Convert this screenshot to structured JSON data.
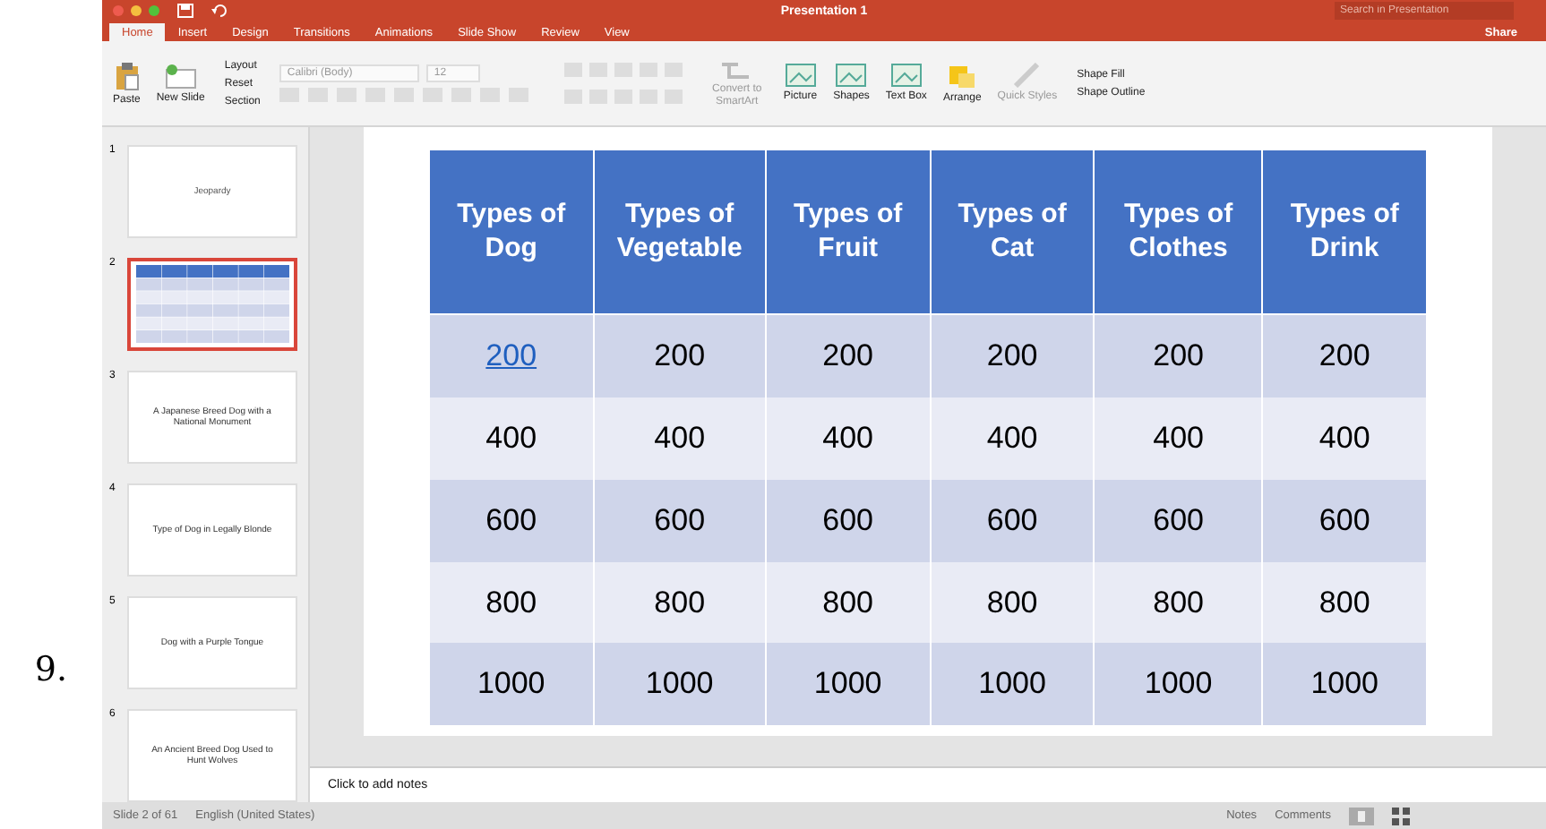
{
  "step_number": "9.",
  "window": {
    "title": "Presentation 1"
  },
  "search": {
    "placeholder": "Search in Presentation"
  },
  "share": "Share",
  "tabs": [
    {
      "label": "Home",
      "selected": true
    },
    {
      "label": "Insert",
      "selected": false
    },
    {
      "label": "Design",
      "selected": false
    },
    {
      "label": "Transitions",
      "selected": false
    },
    {
      "label": "Animations",
      "selected": false
    },
    {
      "label": "Slide Show",
      "selected": false
    },
    {
      "label": "Review",
      "selected": false
    },
    {
      "label": "View",
      "selected": false
    }
  ],
  "ribbon": {
    "paste": "Paste",
    "new_slide": "New Slide",
    "slide_options": [
      "Layout",
      "Reset",
      "Section"
    ],
    "font_name": "Calibri (Body)",
    "font_size": "12",
    "convert": "Convert to SmartArt",
    "insert_buttons": [
      "Picture",
      "Shapes",
      "Text Box"
    ],
    "arrange": "Arrange",
    "quick_styles": "Quick Styles",
    "shape_options": [
      "Shape Fill",
      "Shape Outline"
    ]
  },
  "slides": [
    {
      "number": "1",
      "kind": "title",
      "text": "Jeopardy",
      "selected": false
    },
    {
      "number": "2",
      "kind": "table",
      "selected": true
    },
    {
      "number": "3",
      "kind": "text",
      "text": "A Japanese Breed Dog with a National Monument",
      "selected": false
    },
    {
      "number": "4",
      "kind": "text",
      "text": "Type of Dog in Legally Blonde",
      "selected": false
    },
    {
      "number": "5",
      "kind": "text",
      "text": "Dog with a Purple Tongue",
      "selected": false
    },
    {
      "number": "6",
      "kind": "text",
      "text": "An Ancient Breed Dog Used to Hunt Wolves",
      "selected": false
    }
  ],
  "table": {
    "columns": [
      "Types of Dog",
      "Types of Vegetable",
      "Types of Fruit",
      "Types of Cat",
      "Types of Clothes",
      "Types of Drink"
    ],
    "rows": [
      [
        {
          "text": "200",
          "link": true
        },
        {
          "text": "200",
          "link": false
        },
        {
          "text": "200",
          "link": false
        },
        {
          "text": "200",
          "link": false
        },
        {
          "text": "200",
          "link": false
        },
        {
          "text": "200",
          "link": false
        }
      ],
      [
        {
          "text": "400",
          "link": false
        },
        {
          "text": "400",
          "link": false
        },
        {
          "text": "400",
          "link": false
        },
        {
          "text": "400",
          "link": false
        },
        {
          "text": "400",
          "link": false
        },
        {
          "text": "400",
          "link": false
        }
      ],
      [
        {
          "text": "600",
          "link": false
        },
        {
          "text": "600",
          "link": false
        },
        {
          "text": "600",
          "link": false
        },
        {
          "text": "600",
          "link": false
        },
        {
          "text": "600",
          "link": false
        },
        {
          "text": "600",
          "link": false
        }
      ],
      [
        {
          "text": "800",
          "link": false
        },
        {
          "text": "800",
          "link": false
        },
        {
          "text": "800",
          "link": false
        },
        {
          "text": "800",
          "link": false
        },
        {
          "text": "800",
          "link": false
        },
        {
          "text": "800",
          "link": false
        }
      ],
      [
        {
          "text": "1000",
          "link": false
        },
        {
          "text": "1000",
          "link": false
        },
        {
          "text": "1000",
          "link": false
        },
        {
          "text": "1000",
          "link": false
        },
        {
          "text": "1000",
          "link": false
        },
        {
          "text": "1000",
          "link": false
        }
      ]
    ]
  },
  "notes": {
    "placeholder": "Click to add notes"
  },
  "status_bar": {
    "slide": "Slide 2 of 61",
    "language": "English (United States)",
    "notes": "Notes",
    "comments": "Comments"
  }
}
